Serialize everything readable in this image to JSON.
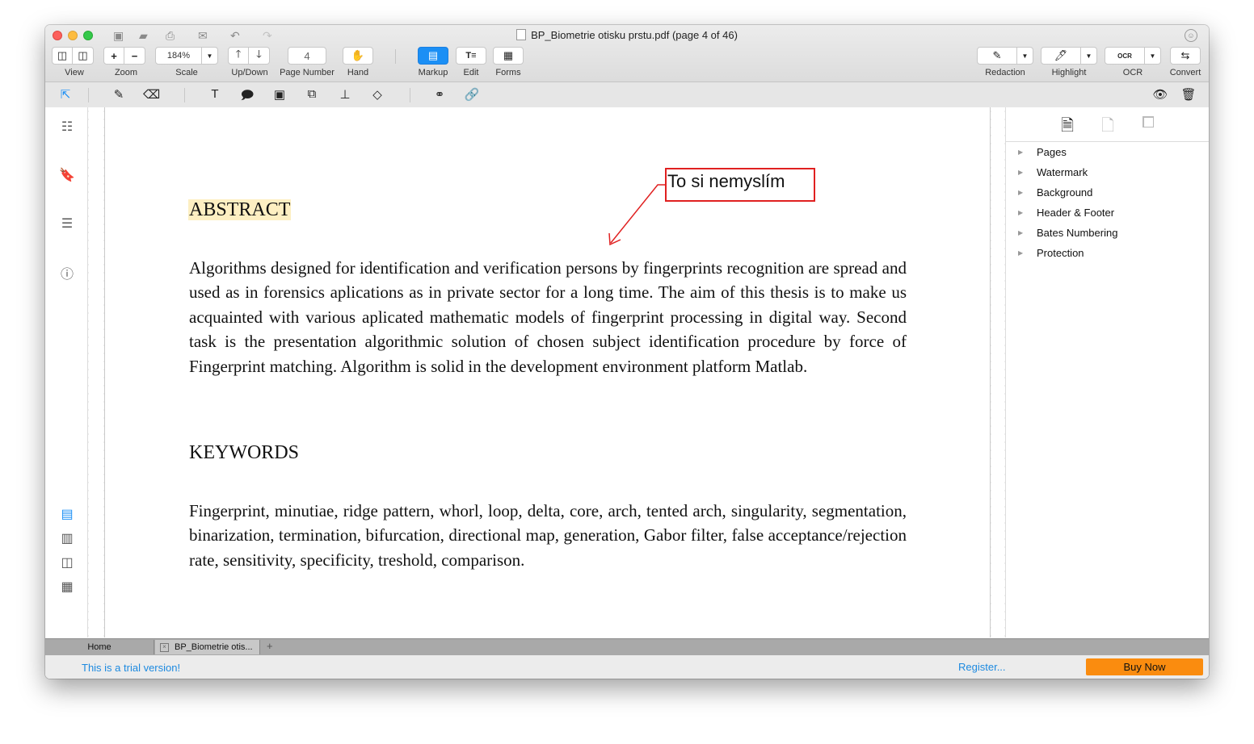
{
  "window": {
    "title": "BP_Biometrie otisku prstu.pdf (page 4 of 46)"
  },
  "toolbar": {
    "scale_value": "184%",
    "page_number_value": "4",
    "labels": {
      "view": "View",
      "zoom": "Zoom",
      "scale": "Scale",
      "updown": "Up/Down",
      "page_number": "Page Number",
      "hand": "Hand",
      "markup": "Markup",
      "edit": "Edit",
      "forms": "Forms",
      "redaction": "Redaction",
      "highlight": "Highlight",
      "ocr": "OCR",
      "convert": "Convert"
    },
    "zoom_in": "+",
    "zoom_out": "−"
  },
  "document": {
    "abstract_heading": "ABSTRACT",
    "abstract_text": "Algorithms designed for identification and verification persons by fingerprints recognition are spread and used as in forensics aplications as in private sector for a long time. The aim of this thesis is to make us acquainted with various aplicated mathematic models of  fingerprint processing in digital way. Second task is the presentation algorithmic solution of chosen subject identification procedure by force of Fingerprint matching. Algorithm is solid in the development environment platform Matlab.",
    "keywords_heading": "KEYWORDS",
    "keywords_text": "Fingerprint, minutiae, ridge pattern, whorl, loop, delta, core, arch, tented arch, singularity, segmentation, binarization, termination, bifurcation, directional map, generation, Gabor filter, false acceptance/rejection rate, sensitivity, specificity, treshold, comparison.",
    "callout_text": "To si nemyslím",
    "callout_color": "#e02020"
  },
  "right_panel": {
    "items": [
      "Pages",
      "Watermark",
      "Background",
      "Header & Footer",
      "Bates Numbering",
      "Protection"
    ]
  },
  "tabs": {
    "home": "Home",
    "doc": "BP_Biometrie otis...",
    "add": "+"
  },
  "status": {
    "trial": "This is a trial version!",
    "register": "Register...",
    "buy_now": "Buy Now",
    "accent": "#1d8ae0",
    "buy_color": "#fa8c0f"
  }
}
